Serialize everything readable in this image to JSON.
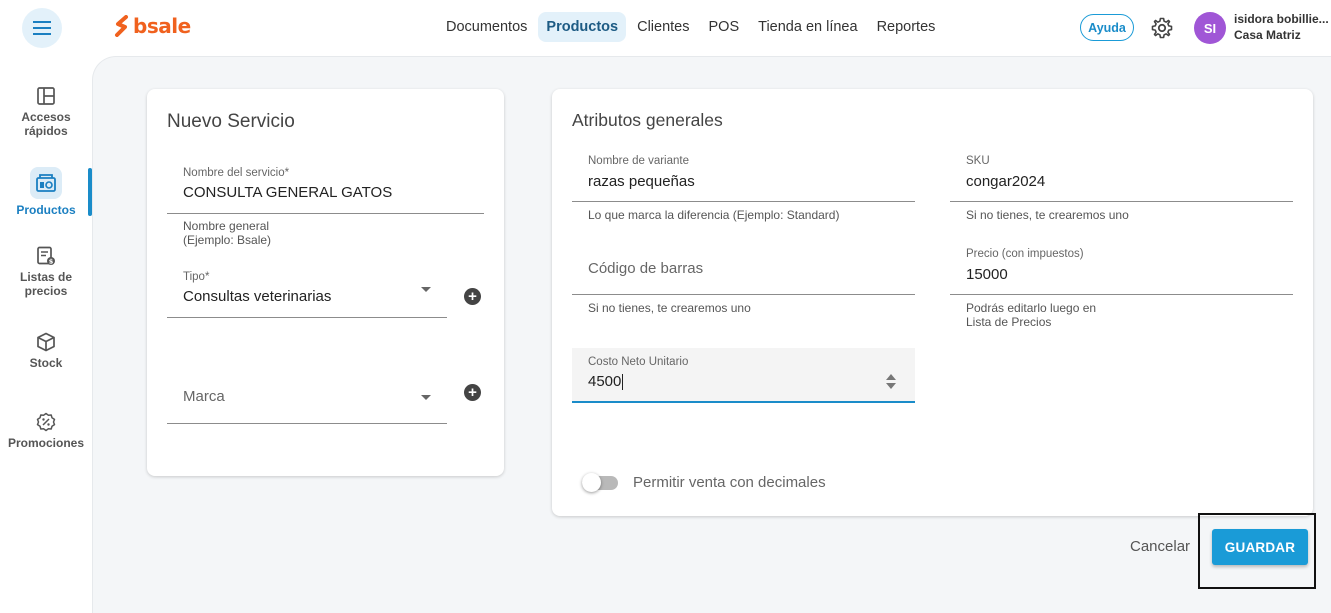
{
  "header": {
    "logo_text": "bsale",
    "nav": [
      "Documentos",
      "Productos",
      "Clientes",
      "POS",
      "Tienda en línea",
      "Reportes"
    ],
    "active_nav": "Productos",
    "help_label": "Ayuda",
    "user_initials": "SI",
    "user_name": "isidora bobillie...",
    "user_branch": "Casa Matriz"
  },
  "sidebar": {
    "items": [
      {
        "label": "Accesos rápidos",
        "icon": "dashboard-icon"
      },
      {
        "label": "Productos",
        "icon": "products-icon"
      },
      {
        "label": "Listas de precios",
        "icon": "price-list-icon"
      },
      {
        "label": "Stock",
        "icon": "box-icon"
      },
      {
        "label": "Promociones",
        "icon": "discount-icon"
      }
    ]
  },
  "left_card": {
    "title": "Nuevo Servicio",
    "service_name_label": "Nombre del servicio*",
    "service_name_value": "CONSULTA GENERAL GATOS",
    "service_name_helper_1": "Nombre general",
    "service_name_helper_2": "(Ejemplo: Bsale)",
    "type_label": "Tipo*",
    "type_value": "Consultas veterinarias",
    "brand_placeholder": "Marca"
  },
  "right_card": {
    "title": "Atributos generales",
    "variant_label": "Nombre de variante",
    "variant_value": "razas pequeñas",
    "variant_helper": "Lo que marca la diferencia (Ejemplo: Standard)",
    "sku_label": "SKU",
    "sku_value": "congar2024",
    "sku_helper": "Si no tienes, te crearemos uno",
    "barcode_placeholder": "Código de barras",
    "barcode_helper": "Si no tienes, te crearemos uno",
    "price_label": "Precio (con impuestos)",
    "price_value": "15000",
    "price_helper_1": "Podrás editarlo luego en",
    "price_helper_2": "Lista de Precios",
    "cost_label": "Costo Neto Unitario",
    "cost_value": "4500",
    "decimals_label": "Permitir venta con decimales",
    "decimals_enabled": false
  },
  "actions": {
    "cancel_label": "Cancelar",
    "save_label": "GUARDAR"
  },
  "colors": {
    "brand_orange": "#f0611e",
    "accent_blue": "#1a9bd7",
    "avatar_purple": "#a056d6"
  }
}
